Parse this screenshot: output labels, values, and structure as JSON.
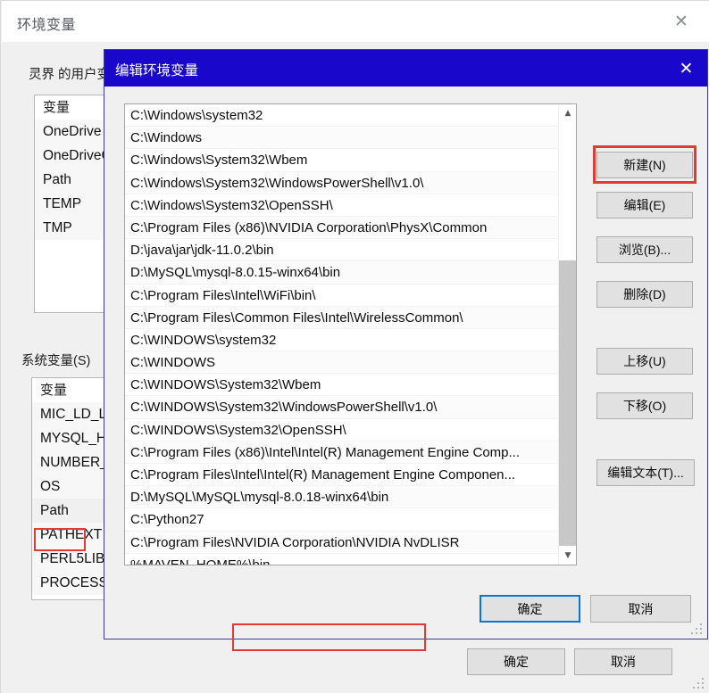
{
  "base_window": {
    "title": "环境变量",
    "close_icon": "close-icon",
    "user_section": {
      "label": "灵界 的用户变量(U)",
      "column_header": "变量",
      "items": [
        "OneDrive",
        "OneDriveC",
        "Path",
        "TEMP",
        "TMP"
      ]
    },
    "system_section": {
      "label": "系统变量(S)",
      "column_header": "变量",
      "items": [
        "MIC_LD_LI",
        "MYSQL_H",
        "NUMBER_",
        "OS",
        "Path",
        "PATHEXT",
        "PERL5LIB",
        "PROCESSO"
      ],
      "selected": "Path"
    },
    "footer": {
      "ok": "确定",
      "cancel": "取消"
    }
  },
  "edit_dialog": {
    "title": "编辑环境变量",
    "close_icon": "close-icon",
    "path_entries": [
      "C:\\Windows\\system32",
      "C:\\Windows",
      "C:\\Windows\\System32\\Wbem",
      "C:\\Windows\\System32\\WindowsPowerShell\\v1.0\\",
      "C:\\Windows\\System32\\OpenSSH\\",
      "C:\\Program Files (x86)\\NVIDIA Corporation\\PhysX\\Common",
      "D:\\java\\jar\\jdk-11.0.2\\bin",
      "D:\\MySQL\\mysql-8.0.15-winx64\\bin",
      "C:\\Program Files\\Intel\\WiFi\\bin\\",
      "C:\\Program Files\\Common Files\\Intel\\WirelessCommon\\",
      "C:\\WINDOWS\\system32",
      "C:\\WINDOWS",
      "C:\\WINDOWS\\System32\\Wbem",
      "C:\\WINDOWS\\System32\\WindowsPowerShell\\v1.0\\",
      "C:\\WINDOWS\\System32\\OpenSSH\\",
      "C:\\Program Files (x86)\\Intel\\Intel(R) Management Engine Comp...",
      "C:\\Program Files\\Intel\\Intel(R) Management Engine Componen...",
      "D:\\MySQL\\MySQL\\mysql-8.0.18-winx64\\bin",
      "C:\\Python27",
      "C:\\Program Files\\NVIDIA Corporation\\NVIDIA NvDLISR",
      "%MAVEN_HOME%\\bin",
      ""
    ],
    "highlighted_entry": "%MAVEN_HOME%\\bin",
    "scrollbar": {
      "up_icon": "chevron-up-icon",
      "down_icon": "chevron-down-icon"
    },
    "buttons": {
      "new": "新建(N)",
      "edit": "编辑(E)",
      "browse": "浏览(B)...",
      "delete": "删除(D)",
      "move_up": "上移(U)",
      "move_down": "下移(O)",
      "edit_text": "编辑文本(T)..."
    },
    "footer": {
      "ok": "确定",
      "cancel": "取消"
    }
  },
  "colors": {
    "titlebar_blue": "#1a07cc",
    "highlight_red": "#e23b34",
    "focus_blue": "#0078d7",
    "dialog_face": "#f0f0f0",
    "button_face": "#e1e1e1"
  }
}
